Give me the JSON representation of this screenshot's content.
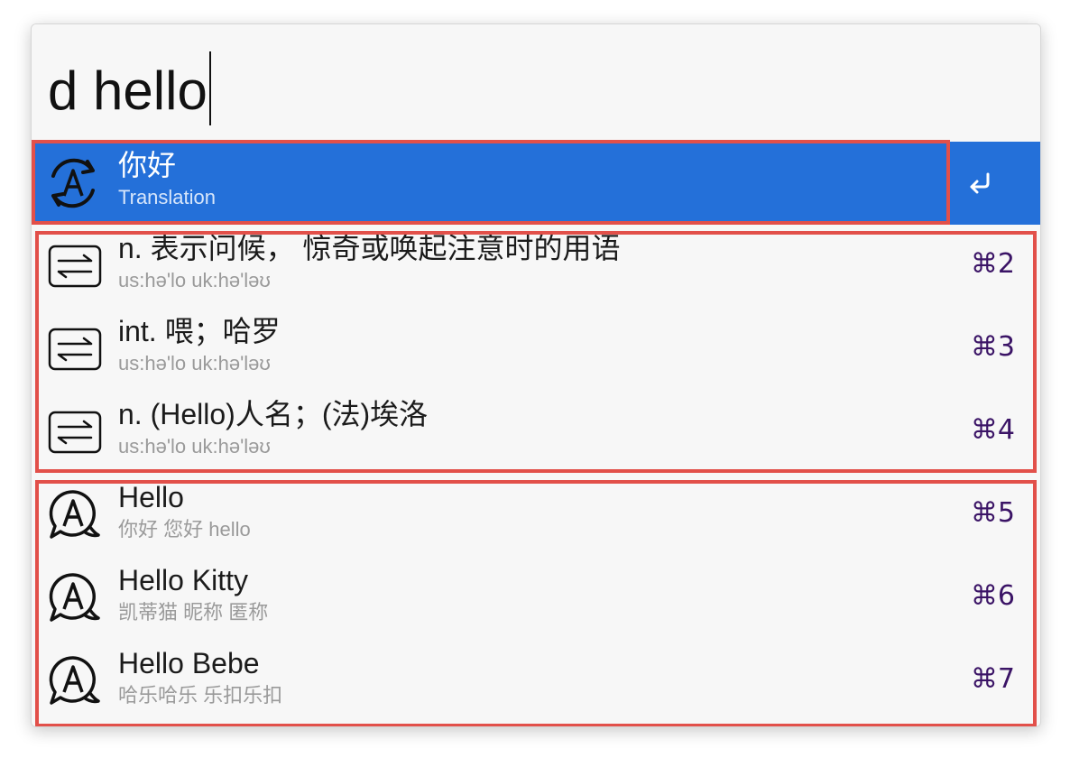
{
  "search": {
    "query": "d hello"
  },
  "results": [
    {
      "title": "你好",
      "subtitle": "Translation",
      "icon": "translate-cycle-icon",
      "selected": true,
      "action_icon": "return-icon"
    },
    {
      "title": "n. 表示问候， 惊奇或唤起注意时的用语",
      "subtitle": "us:hə'lo uk:hə'ləʊ",
      "icon": "exchange-arrows-icon",
      "shortcut": "⌘2"
    },
    {
      "title": "int. 喂；哈罗",
      "subtitle": "us:hə'lo uk:hə'ləʊ",
      "icon": "exchange-arrows-icon",
      "shortcut": "⌘3"
    },
    {
      "title": "n. (Hello)人名；(法)埃洛",
      "subtitle": "us:hə'lo uk:hə'ləʊ",
      "icon": "exchange-arrows-icon",
      "shortcut": "⌘4"
    },
    {
      "title": "Hello",
      "subtitle": "你好 您好 hello",
      "icon": "speech-bubble-a-icon",
      "shortcut": "⌘5"
    },
    {
      "title": "Hello Kitty",
      "subtitle": "凯蒂猫 昵称 匿称",
      "icon": "speech-bubble-a-icon",
      "shortcut": "⌘6"
    },
    {
      "title": "Hello Bebe",
      "subtitle": "哈乐哈乐 乐扣乐扣",
      "icon": "speech-bubble-a-icon",
      "shortcut": "⌘7"
    }
  ],
  "colors": {
    "selection": "#2470d9",
    "shortcut": "#3b1466",
    "annotation_box": "#e2504a"
  }
}
